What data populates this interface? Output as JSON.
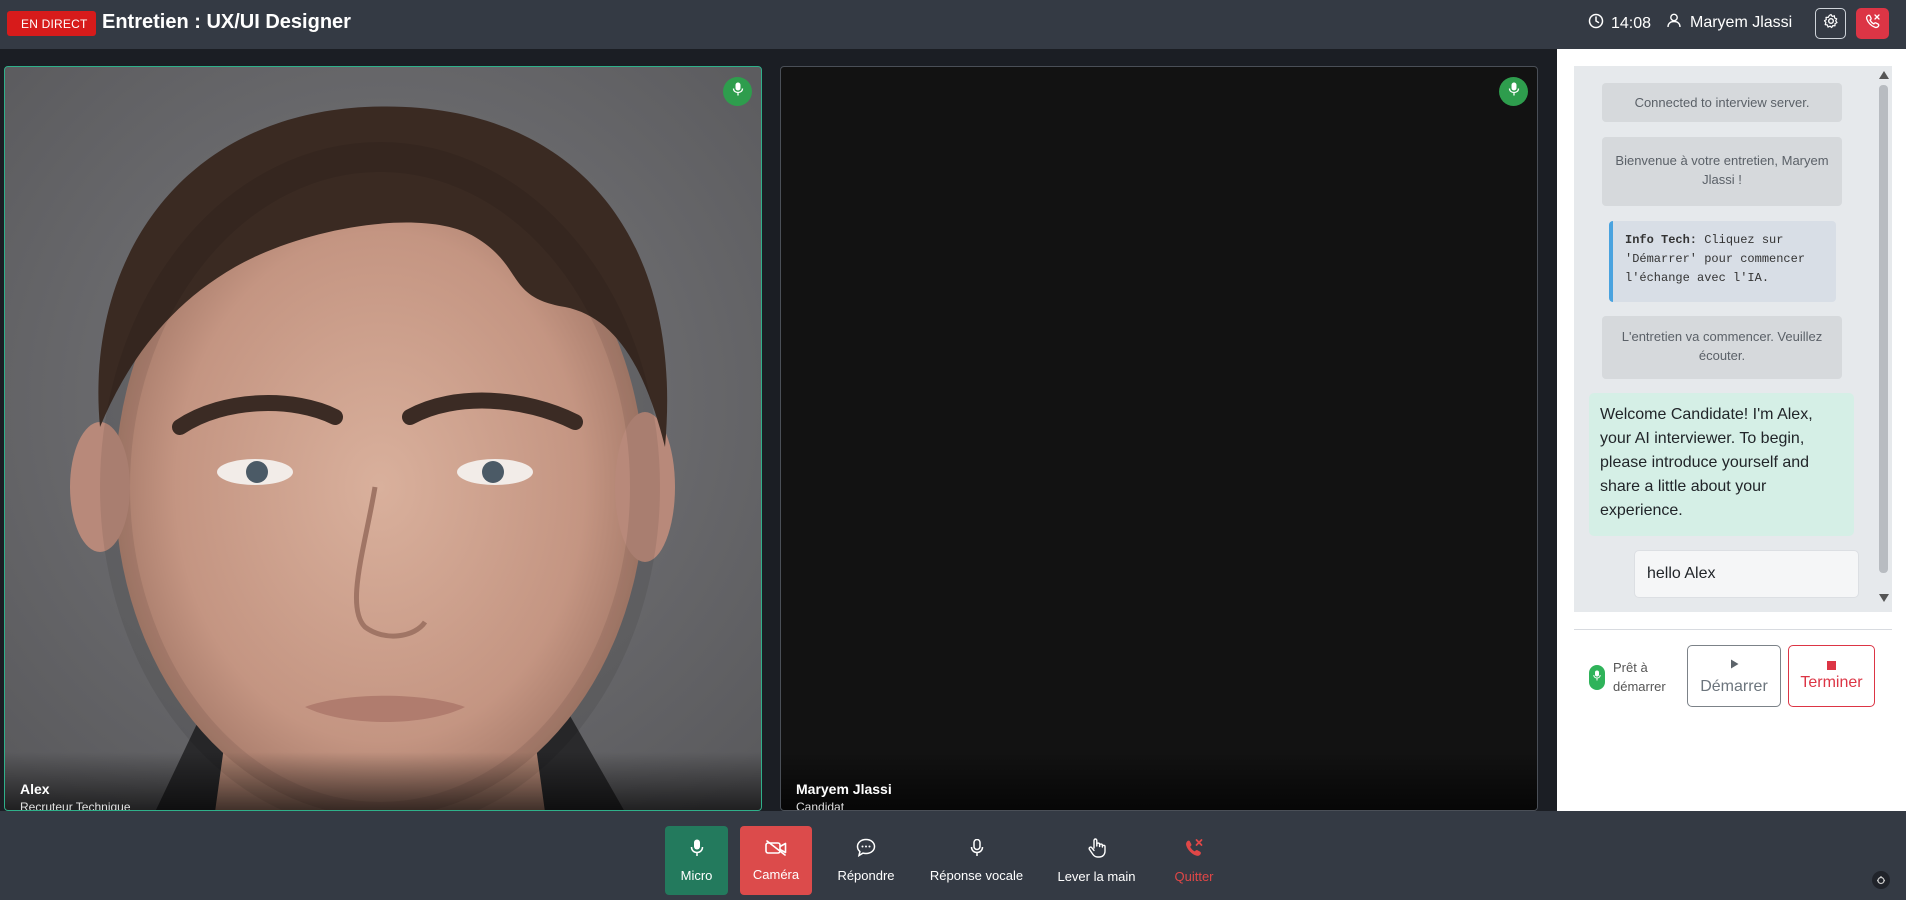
{
  "header": {
    "live_badge": "EN DIRECT",
    "title": "Entretien : UX/UI Designer",
    "time": "14:08",
    "user_name": "Maryem Jlassi",
    "icons": [
      "clock-icon",
      "user-icon",
      "gear-icon",
      "phone-hangup-icon"
    ]
  },
  "participants": [
    {
      "name": "Alex",
      "role": "Recruteur Technique",
      "mic_status": "on",
      "video": "face"
    },
    {
      "name": "Maryem Jlassi",
      "role": "Candidat",
      "mic_status": "on",
      "video": "off"
    }
  ],
  "chat": {
    "messages": [
      {
        "type": "system",
        "text": "Connected to interview server."
      },
      {
        "type": "system",
        "text": "Bienvenue à votre entretien, Maryem Jlassi !"
      },
      {
        "type": "info",
        "label": "Info Tech:",
        "text": "Cliquez sur 'Démarrer' pour commencer l'échange avec l'IA."
      },
      {
        "type": "system",
        "text": "L'entretien va commencer. Veuillez écouter."
      },
      {
        "type": "ai",
        "text": "Welcome Candidate! I'm Alex, your AI interviewer. To begin, please introduce yourself and share a little about your experience."
      },
      {
        "type": "user",
        "text": "hello Alex"
      }
    ]
  },
  "controls": {
    "status": "Prêt à démarrer",
    "start_label": "Démarrer",
    "stop_label": "Terminer"
  },
  "toolbar": {
    "mic_label": "Micro",
    "camera_label": "Caméra",
    "reply_label": "Répondre",
    "voice_label": "Réponse vocale",
    "hand_label": "Lever la main",
    "quit_label": "Quitter"
  },
  "colors": {
    "live": "#d71b1b",
    "accent_green": "#237a5d",
    "danger": "#dc3545",
    "ai_bubble": "#d5efe6",
    "info_border": "#4aa3df"
  }
}
